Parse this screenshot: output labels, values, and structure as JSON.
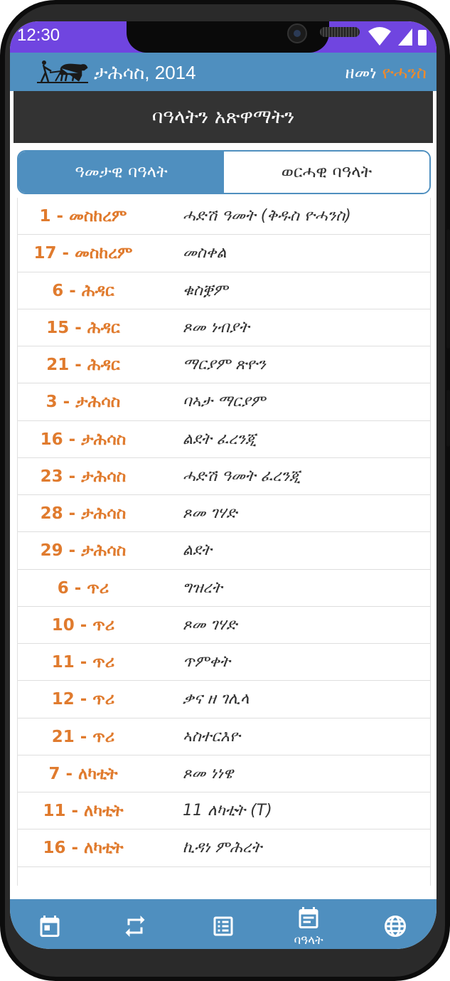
{
  "status_bar": {
    "time": "12:30"
  },
  "app_bar": {
    "title": "ታሕሳስ, 2014",
    "era_label": "ዘመነ",
    "era_name": "ዮሓንስ"
  },
  "page_header": "ባዓላትን አጽዋማትን",
  "tabs": [
    {
      "label": "ዓመታዊ ባዓላት",
      "active": true
    },
    {
      "label": "ወርሓዊ ባዓላት",
      "active": false
    }
  ],
  "holidays": [
    {
      "date": "1 - መስከረም",
      "name": "ሓድሽ ዓመት (ቅዱስ ዮሓንስ)"
    },
    {
      "date": "17 - መስከረም",
      "name": "መስቀል"
    },
    {
      "date": "6 - ሕዳር",
      "name": "ቁስቛም"
    },
    {
      "date": "15 - ሕዳር",
      "name": "ጾመ ነብያት"
    },
    {
      "date": "21 - ሕዳር",
      "name": "ማርያም ጽዮን"
    },
    {
      "date": "3 - ታሕሳስ",
      "name": "ባኣታ ማርያም"
    },
    {
      "date": "16 - ታሕሳስ",
      "name": "ልደት ፈረንጂ"
    },
    {
      "date": "23 - ታሕሳስ",
      "name": "ሓድሽ ዓመት ፈረንጂ"
    },
    {
      "date": "28 - ታሕሳስ",
      "name": "ጾመ ገሃድ"
    },
    {
      "date": "29 - ታሕሳስ",
      "name": "ልደት"
    },
    {
      "date": "6 - ጥሪ",
      "name": "ግዝረት"
    },
    {
      "date": "10 - ጥሪ",
      "name": "ጾመ ገሃድ"
    },
    {
      "date": "11 - ጥሪ",
      "name": "ጥምቀት"
    },
    {
      "date": "12 - ጥሪ",
      "name": "ቃና ዘ ገሊላ"
    },
    {
      "date": "21 - ጥሪ",
      "name": "ኣስተርእዮ"
    },
    {
      "date": "7 - ለካቲት",
      "name": "ጾመ ነነዌ"
    },
    {
      "date": "11 - ለካቲት",
      "name": "11 ለካቲት (T)"
    },
    {
      "date": "16 - ለካቲት",
      "name": "ኪዳነ ምሕረት"
    }
  ],
  "bottom_nav": [
    {
      "icon": "calendar-icon"
    },
    {
      "icon": "convert-icon"
    },
    {
      "icon": "list-icon"
    },
    {
      "icon": "events-icon",
      "label": "ባዓላት",
      "active": true
    },
    {
      "icon": "globe-icon"
    }
  ],
  "colors": {
    "primary": "#4f8fbf",
    "accent": "#e07b2e",
    "header": "#333333",
    "status_bar": "#7045e0"
  }
}
